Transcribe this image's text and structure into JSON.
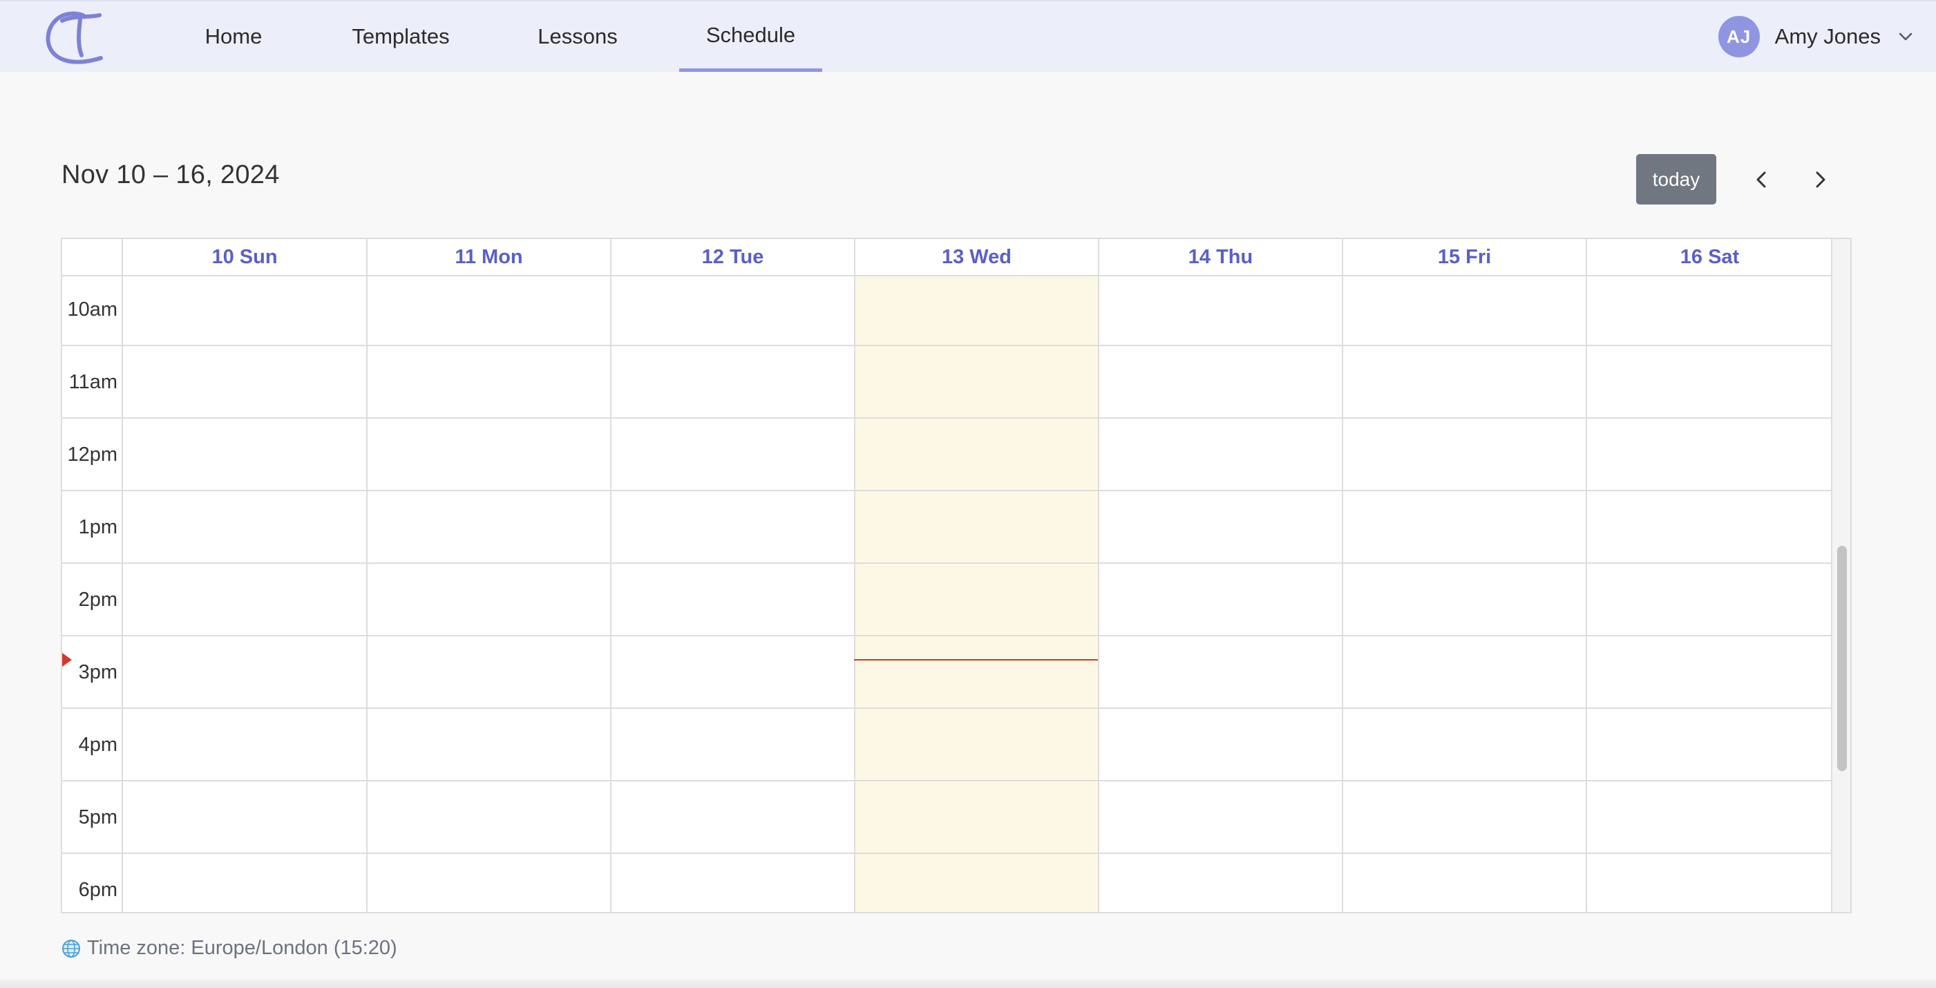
{
  "nav": {
    "logo_alt": "T",
    "tabs": [
      {
        "label": "Home",
        "active": false
      },
      {
        "label": "Templates",
        "active": false
      },
      {
        "label": "Lessons",
        "active": false
      },
      {
        "label": "Schedule",
        "active": true
      }
    ],
    "user": {
      "initials": "AJ",
      "name": "Amy Jones"
    }
  },
  "toolbar": {
    "range_title": "Nov 10 – 16, 2024",
    "today_label": "today",
    "prev_icon": "chevron-left-icon",
    "next_icon": "chevron-right-icon"
  },
  "calendar": {
    "days": [
      "10 Sun",
      "11 Mon",
      "12 Tue",
      "13 Wed",
      "14 Thu",
      "15 Fri",
      "16 Sat"
    ],
    "today_index": 3,
    "hours": [
      "10am",
      "11am",
      "12pm",
      "1pm",
      "2pm",
      "3pm",
      "4pm",
      "5pm",
      "6pm"
    ],
    "current_time": "15:20"
  },
  "footer": {
    "timezone_text": "Time zone: Europe/London (15:20)",
    "globe_icon": "globe-icon"
  },
  "colors": {
    "accent": "#5a5fc8",
    "nav_bg": "#eceefa",
    "today_bg": "#fdf8e5",
    "now_indicator": "#d9362a"
  }
}
